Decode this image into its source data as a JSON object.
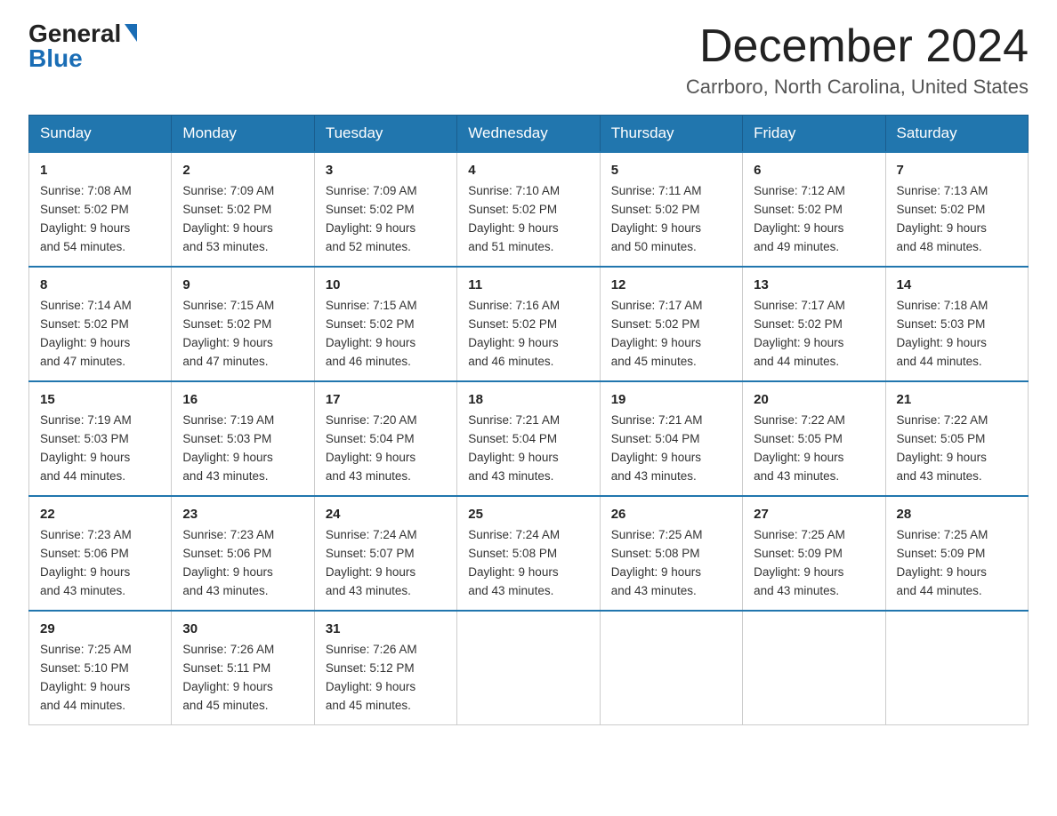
{
  "header": {
    "logo_general": "General",
    "logo_blue": "Blue",
    "month": "December 2024",
    "location": "Carrboro, North Carolina, United States"
  },
  "weekdays": [
    "Sunday",
    "Monday",
    "Tuesday",
    "Wednesday",
    "Thursday",
    "Friday",
    "Saturday"
  ],
  "weeks": [
    [
      {
        "day": "1",
        "sunrise": "7:08 AM",
        "sunset": "5:02 PM",
        "daylight": "9 hours and 54 minutes."
      },
      {
        "day": "2",
        "sunrise": "7:09 AM",
        "sunset": "5:02 PM",
        "daylight": "9 hours and 53 minutes."
      },
      {
        "day": "3",
        "sunrise": "7:09 AM",
        "sunset": "5:02 PM",
        "daylight": "9 hours and 52 minutes."
      },
      {
        "day": "4",
        "sunrise": "7:10 AM",
        "sunset": "5:02 PM",
        "daylight": "9 hours and 51 minutes."
      },
      {
        "day": "5",
        "sunrise": "7:11 AM",
        "sunset": "5:02 PM",
        "daylight": "9 hours and 50 minutes."
      },
      {
        "day": "6",
        "sunrise": "7:12 AM",
        "sunset": "5:02 PM",
        "daylight": "9 hours and 49 minutes."
      },
      {
        "day": "7",
        "sunrise": "7:13 AM",
        "sunset": "5:02 PM",
        "daylight": "9 hours and 48 minutes."
      }
    ],
    [
      {
        "day": "8",
        "sunrise": "7:14 AM",
        "sunset": "5:02 PM",
        "daylight": "9 hours and 47 minutes."
      },
      {
        "day": "9",
        "sunrise": "7:15 AM",
        "sunset": "5:02 PM",
        "daylight": "9 hours and 47 minutes."
      },
      {
        "day": "10",
        "sunrise": "7:15 AM",
        "sunset": "5:02 PM",
        "daylight": "9 hours and 46 minutes."
      },
      {
        "day": "11",
        "sunrise": "7:16 AM",
        "sunset": "5:02 PM",
        "daylight": "9 hours and 46 minutes."
      },
      {
        "day": "12",
        "sunrise": "7:17 AM",
        "sunset": "5:02 PM",
        "daylight": "9 hours and 45 minutes."
      },
      {
        "day": "13",
        "sunrise": "7:17 AM",
        "sunset": "5:02 PM",
        "daylight": "9 hours and 44 minutes."
      },
      {
        "day": "14",
        "sunrise": "7:18 AM",
        "sunset": "5:03 PM",
        "daylight": "9 hours and 44 minutes."
      }
    ],
    [
      {
        "day": "15",
        "sunrise": "7:19 AM",
        "sunset": "5:03 PM",
        "daylight": "9 hours and 44 minutes."
      },
      {
        "day": "16",
        "sunrise": "7:19 AM",
        "sunset": "5:03 PM",
        "daylight": "9 hours and 43 minutes."
      },
      {
        "day": "17",
        "sunrise": "7:20 AM",
        "sunset": "5:04 PM",
        "daylight": "9 hours and 43 minutes."
      },
      {
        "day": "18",
        "sunrise": "7:21 AM",
        "sunset": "5:04 PM",
        "daylight": "9 hours and 43 minutes."
      },
      {
        "day": "19",
        "sunrise": "7:21 AM",
        "sunset": "5:04 PM",
        "daylight": "9 hours and 43 minutes."
      },
      {
        "day": "20",
        "sunrise": "7:22 AM",
        "sunset": "5:05 PM",
        "daylight": "9 hours and 43 minutes."
      },
      {
        "day": "21",
        "sunrise": "7:22 AM",
        "sunset": "5:05 PM",
        "daylight": "9 hours and 43 minutes."
      }
    ],
    [
      {
        "day": "22",
        "sunrise": "7:23 AM",
        "sunset": "5:06 PM",
        "daylight": "9 hours and 43 minutes."
      },
      {
        "day": "23",
        "sunrise": "7:23 AM",
        "sunset": "5:06 PM",
        "daylight": "9 hours and 43 minutes."
      },
      {
        "day": "24",
        "sunrise": "7:24 AM",
        "sunset": "5:07 PM",
        "daylight": "9 hours and 43 minutes."
      },
      {
        "day": "25",
        "sunrise": "7:24 AM",
        "sunset": "5:08 PM",
        "daylight": "9 hours and 43 minutes."
      },
      {
        "day": "26",
        "sunrise": "7:25 AM",
        "sunset": "5:08 PM",
        "daylight": "9 hours and 43 minutes."
      },
      {
        "day": "27",
        "sunrise": "7:25 AM",
        "sunset": "5:09 PM",
        "daylight": "9 hours and 43 minutes."
      },
      {
        "day": "28",
        "sunrise": "7:25 AM",
        "sunset": "5:09 PM",
        "daylight": "9 hours and 44 minutes."
      }
    ],
    [
      {
        "day": "29",
        "sunrise": "7:25 AM",
        "sunset": "5:10 PM",
        "daylight": "9 hours and 44 minutes."
      },
      {
        "day": "30",
        "sunrise": "7:26 AM",
        "sunset": "5:11 PM",
        "daylight": "9 hours and 45 minutes."
      },
      {
        "day": "31",
        "sunrise": "7:26 AM",
        "sunset": "5:12 PM",
        "daylight": "9 hours and 45 minutes."
      },
      null,
      null,
      null,
      null
    ]
  ],
  "labels": {
    "sunrise": "Sunrise:",
    "sunset": "Sunset:",
    "daylight": "Daylight:"
  }
}
